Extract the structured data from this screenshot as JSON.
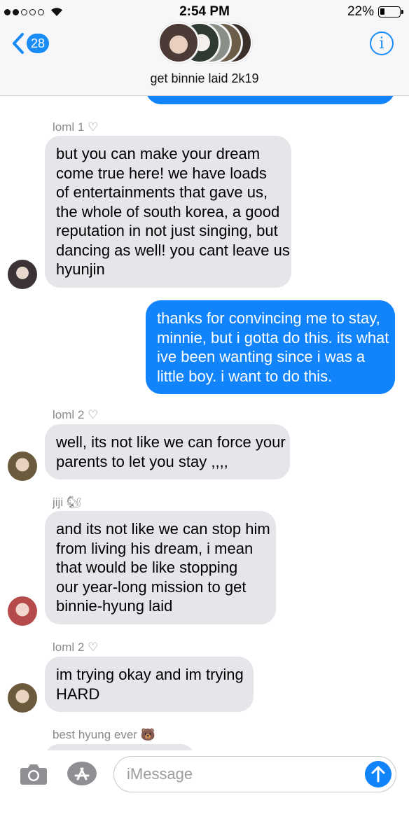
{
  "status_bar": {
    "time": "2:54 PM",
    "battery_percent": "22%",
    "signal_bars_filled": 2,
    "signal_bars_total": 5
  },
  "nav": {
    "back_badge": "28",
    "group_name": "get binnie laid 2k19",
    "info_icon": "i"
  },
  "colors": {
    "accent": "#1a8cf5",
    "outgoing_bubble": "#1183fb",
    "incoming_bubble": "#e5e5ea",
    "sender_label": "#8a8a8e"
  },
  "messages": [
    {
      "sender": "loml 1 ♡",
      "direction": "incoming",
      "lines": [
        "but you can make your dream",
        "come true here! we have loads",
        "of entertainments that gave us,",
        "the whole of south korea, a good",
        "reputation in not just singing, but",
        "dancing as well! you cant leave us",
        "hyunjin"
      ]
    },
    {
      "direction": "outgoing",
      "lines": [
        "thanks for convincing me to stay,",
        "minnie, but i gotta do this. its what",
        "ive been wanting since i was a",
        "little boy. i want to do this."
      ]
    },
    {
      "sender": "loml 2 ♡",
      "direction": "incoming",
      "lines": [
        "well, its not like we can force your",
        "parents to let you stay ,,,,"
      ]
    },
    {
      "sender": "jiji 🐿",
      "direction": "incoming",
      "lines": [
        "and its not like we can stop him",
        "from living his dream, i mean",
        "that would be like stopping",
        "our year-long mission to get",
        "binnie-hyung laid"
      ]
    },
    {
      "sender": "loml 2 ♡",
      "direction": "incoming",
      "lines": [
        "im trying okay and im trying",
        "HARD"
      ]
    },
    {
      "sender": "best hyung ever 🐻",
      "direction": "incoming",
      "lines": []
    }
  ],
  "compose": {
    "placeholder": "iMessage",
    "value": "",
    "camera_icon": "camera-icon",
    "apps_icon": "app-store-icon",
    "send_icon": "send-arrow-icon"
  }
}
